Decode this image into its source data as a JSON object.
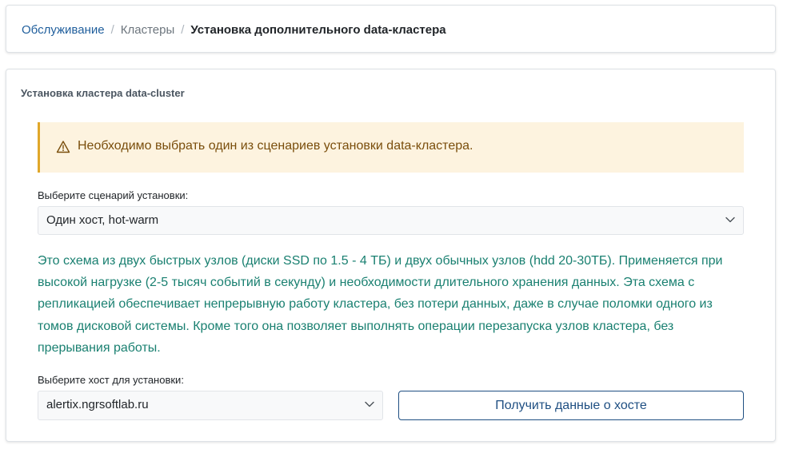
{
  "breadcrumb": {
    "items": [
      {
        "label": "Обслуживание"
      },
      {
        "label": "Кластеры"
      },
      {
        "label": "Установка дополнительного data-кластера"
      }
    ],
    "separator": "/"
  },
  "card": {
    "title": "Установка кластера data-cluster"
  },
  "alert": {
    "icon": "warning-icon",
    "text": "Необходимо выбрать один из сценариев установки data-кластера."
  },
  "scenario": {
    "label": "Выберите сценарий установки:",
    "value": "Один хост, hot-warm"
  },
  "description": "Это схема из двух быстрых узлов (диски SSD по 1.5 - 4 ТБ) и двух обычных узлов (hdd 20-30ТБ). Применяется при высокой нагрузке (2-5 тысяч событий в секунду) и необходимости длительного хранения данных. Эта схема с репликацией обеспечивает непрерывную работу кластера, без потери данных, даже в случае поломки одного из томов дисковой системы. Кроме того она позволяет выполнять операции перезапуска узлов кластера, без прерывания работы.",
  "host": {
    "label": "Выберите хост для установки:",
    "value": "alertix.ngrsoftlab.ru"
  },
  "fetch_button": {
    "label": "Получить данные о хосте"
  },
  "colors": {
    "link": "#1f5e9c",
    "alert_bg": "#fdf3df",
    "alert_border": "#e0a72a",
    "alert_text": "#7a4e0c",
    "description_text": "#1a8071",
    "button_border": "#1f4f82"
  }
}
